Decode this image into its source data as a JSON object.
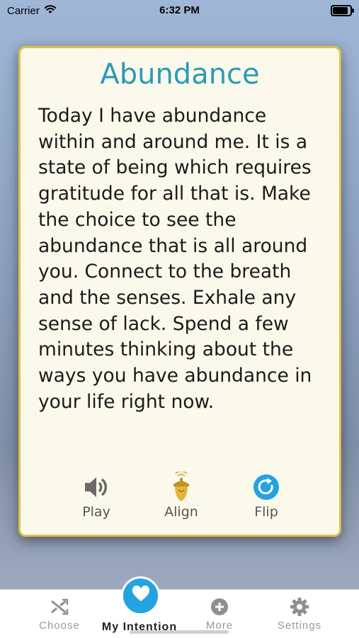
{
  "status_bar": {
    "carrier": "Carrier",
    "time": "6:32 PM",
    "battery_level": 0.95
  },
  "card": {
    "title": "Abundance",
    "body": "Today I have abundance within and around me. It is a state of being which requires gratitude for all that is. Make the choice to see the abundance that is all around you. Connect to the breath and the senses. Exhale any sense of lack. Spend a few minutes thinking about the ways you have abundance in your life right now.",
    "actions": {
      "play": "Play",
      "align": "Align",
      "flip": "Flip"
    }
  },
  "tab_bar": {
    "choose": "Choose",
    "my_intention": "My Intention",
    "more": "More",
    "settings": "Settings"
  },
  "colors": {
    "title": "#2b9bb5",
    "card_border": "#e0bf45",
    "accent_blue": "#23a3e0",
    "align_gold": "#d6a82a"
  },
  "icons": {
    "play": "speaker-icon",
    "align": "acorn-icon",
    "flip": "flip-arrow-icon",
    "choose": "shuffle-icon",
    "my_intention": "heart-icon",
    "more": "plus-circle-icon",
    "settings": "gear-icon"
  }
}
